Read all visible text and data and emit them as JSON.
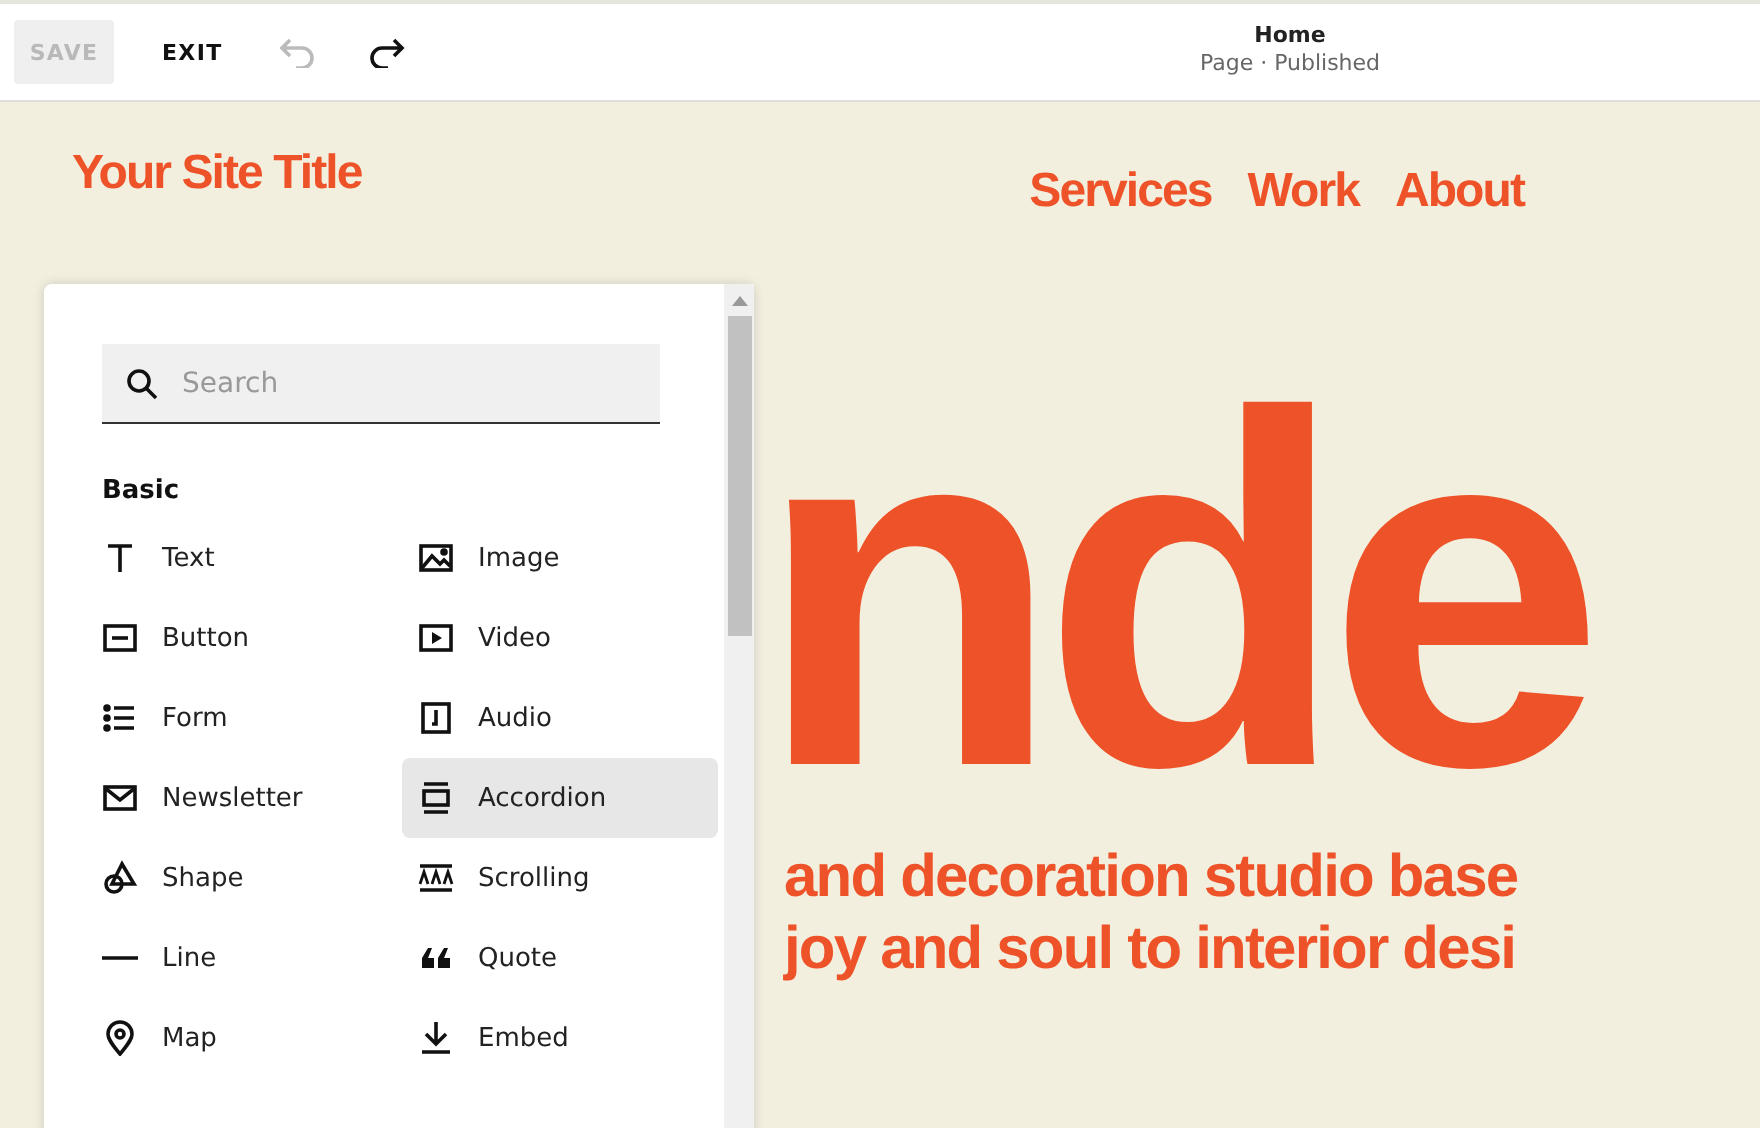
{
  "toolbar": {
    "save": {
      "label": "SAVE",
      "disabled": true
    },
    "exit": "EXIT",
    "undo": {
      "disabled": true
    },
    "redo": {
      "disabled": false
    }
  },
  "page_info": {
    "title": "Home",
    "subtitle": "Page · Published"
  },
  "site": {
    "title": "Your Site Title",
    "nav": [
      "Services",
      "Work",
      "About"
    ]
  },
  "hero": {
    "heading": "nde",
    "lines": [
      "and decoration studio base",
      "joy and soul to interior desi"
    ]
  },
  "block_panel": {
    "search": {
      "placeholder": "Search"
    },
    "section": "Basic",
    "items": [
      {
        "label": "Text",
        "selected": false
      },
      {
        "label": "Image",
        "selected": false
      },
      {
        "label": "Button",
        "selected": false
      },
      {
        "label": "Video",
        "selected": false
      },
      {
        "label": "Form",
        "selected": false
      },
      {
        "label": "Audio",
        "selected": false
      },
      {
        "label": "Newsletter",
        "selected": false
      },
      {
        "label": "Accordion",
        "selected": true
      },
      {
        "label": "Shape",
        "selected": false
      },
      {
        "label": "Scrolling",
        "selected": false
      },
      {
        "label": "Line",
        "selected": false
      },
      {
        "label": "Quote",
        "selected": false
      },
      {
        "label": "Map",
        "selected": false
      },
      {
        "label": "Embed",
        "selected": false
      }
    ]
  }
}
